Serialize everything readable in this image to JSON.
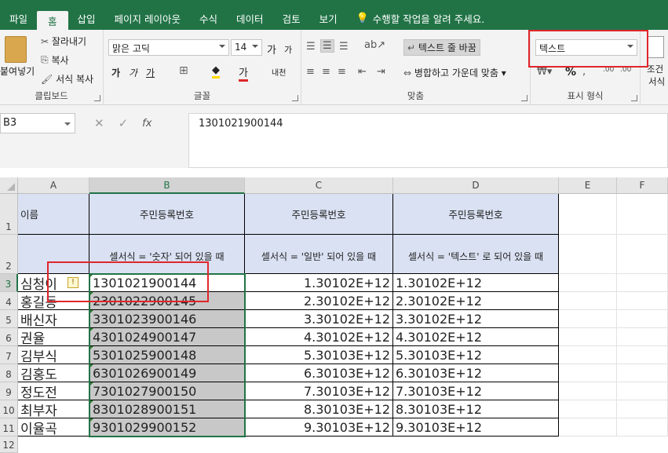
{
  "tabs": [
    {
      "label": "파일"
    },
    {
      "label": "홈"
    },
    {
      "label": "삽입"
    },
    {
      "label": "페이지 레이아웃"
    },
    {
      "label": "수식"
    },
    {
      "label": "데이터"
    },
    {
      "label": "검토"
    },
    {
      "label": "보기"
    },
    {
      "label": "수행할 작업을 알려 주세요."
    }
  ],
  "ribbon": {
    "clipboard": {
      "paste": "붙여넣기",
      "cut": "잘라내기",
      "copy": "복사",
      "format_painter": "서식 복사",
      "group": "클립보드"
    },
    "font": {
      "font_name": "맑은 고딕",
      "font_size": "14",
      "grow": "가",
      "shrink": "가",
      "bold": "가",
      "italic": "가",
      "underline": "가",
      "phonetic": "내천",
      "group": "글꼴"
    },
    "align": {
      "wrap": "텍스트 줄 바꿈",
      "merge": "병합하고 가운데 맞춤",
      "group": "맞춤"
    },
    "number": {
      "format": "텍스트",
      "percent": "%",
      "group": "표시 형식"
    },
    "styles": {
      "cond": "조건",
      "format": "서식"
    }
  },
  "formula_bar": {
    "name_box": "B3",
    "fx": "fx",
    "value": "1301021900144"
  },
  "grid": {
    "columns": [
      "A",
      "B",
      "C",
      "D",
      "E",
      "F"
    ],
    "rows": [
      "1",
      "2",
      "3",
      "4",
      "5",
      "6",
      "7",
      "8",
      "9",
      "10",
      "11",
      "12"
    ],
    "header_row": {
      "a": "이름",
      "b": "주민등록번호",
      "c": "주민등록번호",
      "d": "주민등록번호"
    },
    "note_row": {
      "b": "셀서식 = '숫자' 되어 있을 때",
      "c": "셀서식 = '일반' 되어 있을 때",
      "d": "셀서식 = '텍스트' 로 되어 있을 때"
    },
    "data": [
      {
        "name": "심청이",
        "b": "1301021900144",
        "c": "1.30102E+12",
        "d": "1.30102E+12"
      },
      {
        "name": "홍길동",
        "b": "2301022900145",
        "c": "2.30102E+12",
        "d": "2.30102E+12"
      },
      {
        "name": "배신자",
        "b": "3301023900146",
        "c": "3.30102E+12",
        "d": "3.30102E+12"
      },
      {
        "name": "권율",
        "b": "4301024900147",
        "c": "4.30102E+12",
        "d": "4.30102E+12"
      },
      {
        "name": "김부식",
        "b": "5301025900148",
        "c": "5.30103E+12",
        "d": "5.30103E+12"
      },
      {
        "name": "김홍도",
        "b": "6301026900149",
        "c": "6.30103E+12",
        "d": "6.30103E+12"
      },
      {
        "name": "정도전",
        "b": "7301027900150",
        "c": "7.30103E+12",
        "d": "7.30103E+12"
      },
      {
        "name": "최부자",
        "b": "8301028900151",
        "c": "8.30103E+12",
        "d": "8.30103E+12"
      },
      {
        "name": "이율곡",
        "b": "9301029900152",
        "c": "9.30103E+12",
        "d": "9.30103E+12"
      }
    ]
  },
  "colors": {
    "excel_green": "#217346",
    "header_fill": "#d9e1f2",
    "highlight": "#e0262c",
    "selection_fill": "#c8c8c8"
  }
}
